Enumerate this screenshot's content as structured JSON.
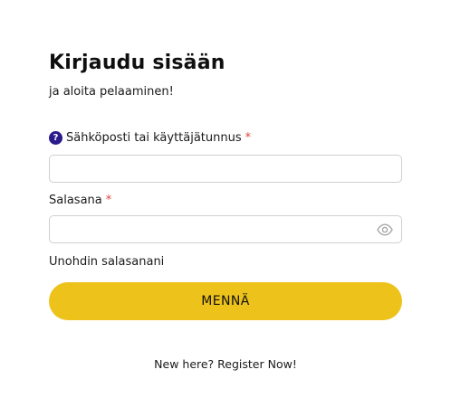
{
  "login": {
    "title": "Kirjaudu sisään",
    "subtitle": "ja aloita pelaaminen!",
    "email_field": {
      "help_icon_glyph": "?",
      "label": "Sähköposti tai käyttäjätunnus",
      "required_mark": "*",
      "value": "",
      "placeholder": ""
    },
    "password_field": {
      "label": "Salasana",
      "required_mark": "*",
      "value": "",
      "placeholder": "",
      "toggle_icon": "eye-icon"
    },
    "forgot_link": "Unohdin salasanani",
    "submit_label": "MENNÄ",
    "register_prompt": "New here?",
    "register_link": "Register Now!"
  },
  "colors": {
    "accent_button": "#ecc21b",
    "help_icon": "#2b1a8c",
    "required": "#e0463a"
  }
}
